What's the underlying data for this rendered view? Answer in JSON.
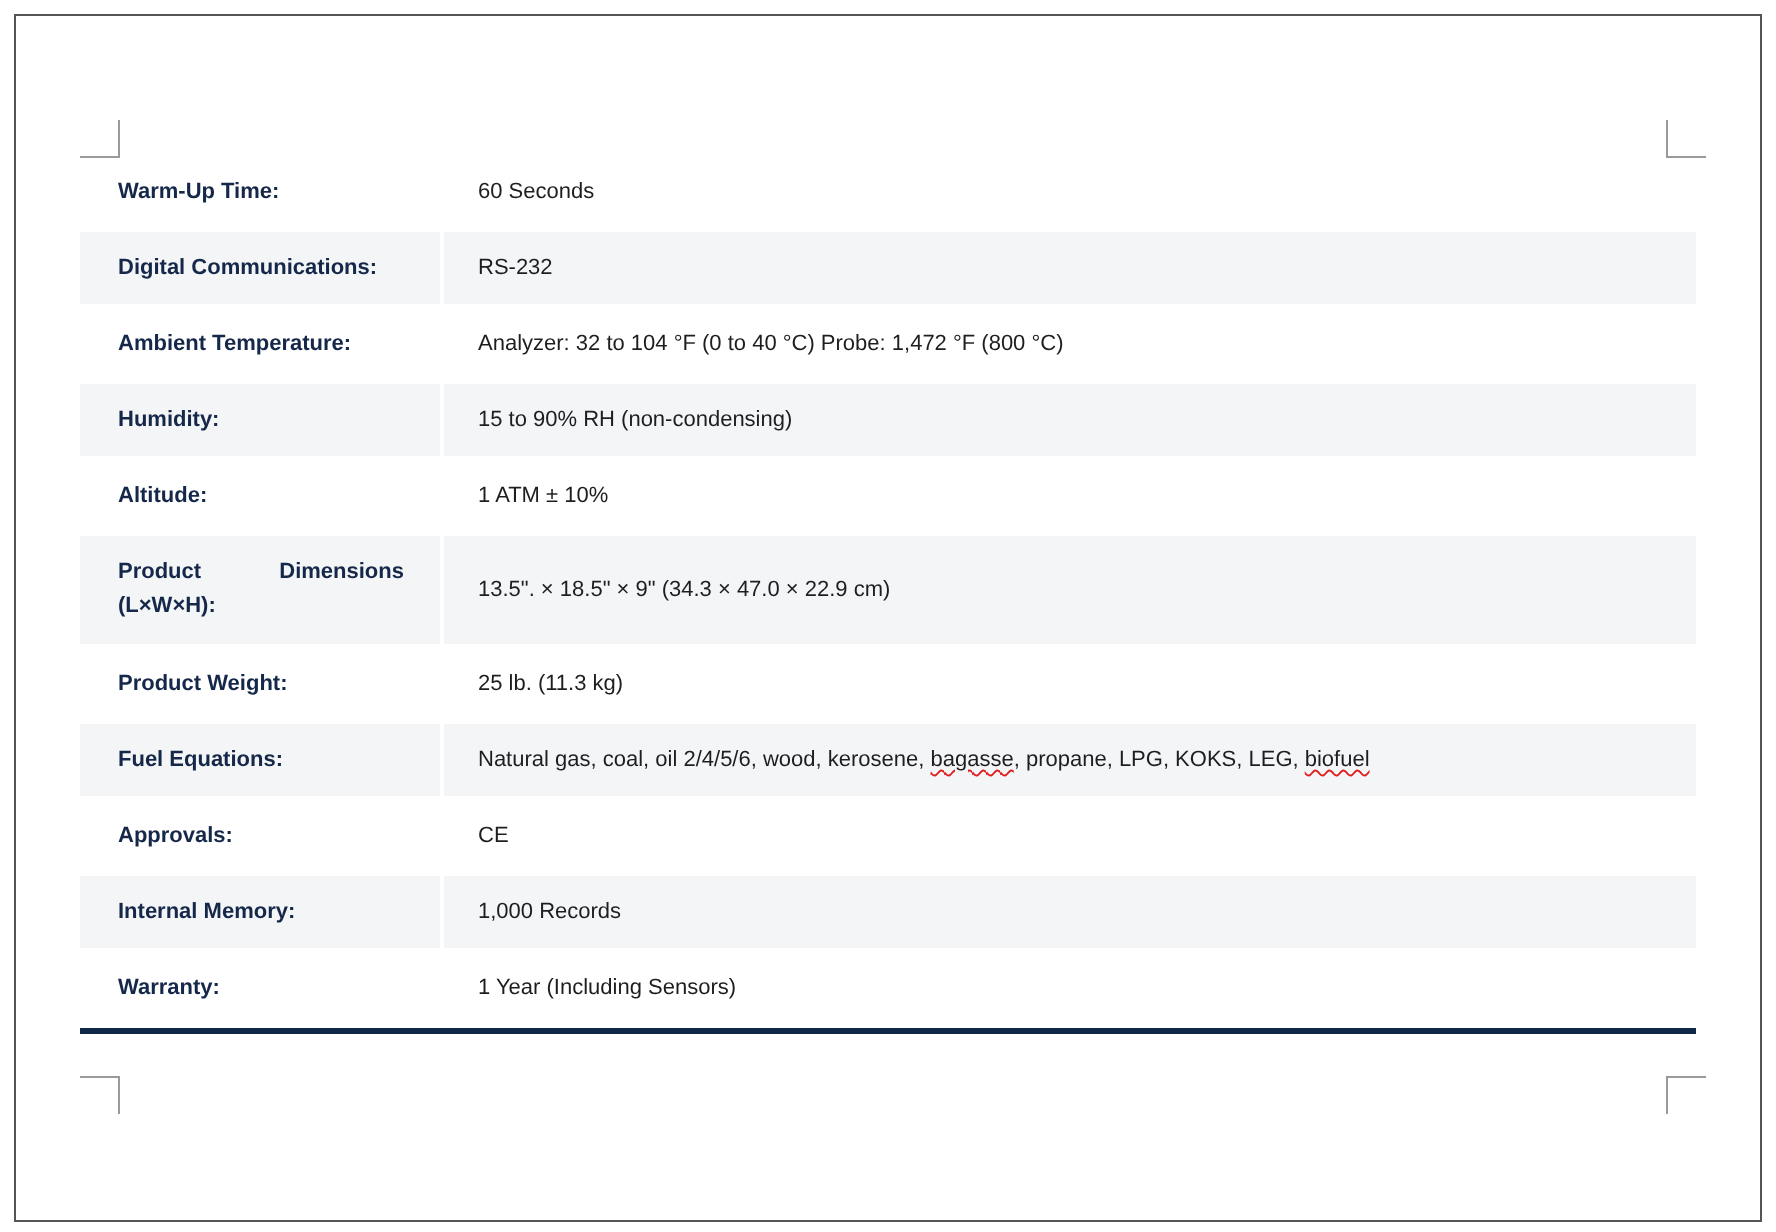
{
  "specs": [
    {
      "label": "Warm-Up Time:",
      "value": [
        {
          "text": "60 Seconds",
          "misspelled": false
        }
      ]
    },
    {
      "label": "Digital Communications:",
      "value": [
        {
          "text": "RS-232",
          "misspelled": false
        }
      ]
    },
    {
      "label": "Ambient Temperature:",
      "value": [
        {
          "text": "Analyzer: 32 to 104 °F (0 to 40 °C) Probe: 1,472 °F (800 °C)",
          "misspelled": false
        }
      ]
    },
    {
      "label": "Humidity:",
      "value": [
        {
          "text": "15 to 90% RH (non-condensing)",
          "misspelled": false
        }
      ]
    },
    {
      "label": "Altitude:",
      "value": [
        {
          "text": "1 ATM ± 10%",
          "misspelled": false
        }
      ]
    },
    {
      "label": "Product Dimensions (L×W×H):",
      "value": [
        {
          "text": "13.5\". × 18.5\" × 9\" (34.3 × 47.0 × 22.9 cm)",
          "misspelled": false
        }
      ]
    },
    {
      "label": "Product Weight:",
      "value": [
        {
          "text": "25 lb. (11.3 kg)",
          "misspelled": false
        }
      ]
    },
    {
      "label": "Fuel Equations:",
      "value": [
        {
          "text": "Natural gas, coal, oil 2/4/5/6, wood, kerosene, ",
          "misspelled": false
        },
        {
          "text": "bagasse",
          "misspelled": true
        },
        {
          "text": ", propane, LPG, KOKS, LEG, ",
          "misspelled": false
        },
        {
          "text": "biofuel",
          "misspelled": true
        }
      ]
    },
    {
      "label": "Approvals:",
      "value": [
        {
          "text": "CE",
          "misspelled": false
        }
      ]
    },
    {
      "label": "Internal Memory:",
      "value": [
        {
          "text": "1,000 Records",
          "misspelled": false
        }
      ]
    },
    {
      "label": "Warranty:",
      "value": [
        {
          "text": "1 Year (Including Sensors)",
          "misspelled": false
        }
      ]
    }
  ]
}
